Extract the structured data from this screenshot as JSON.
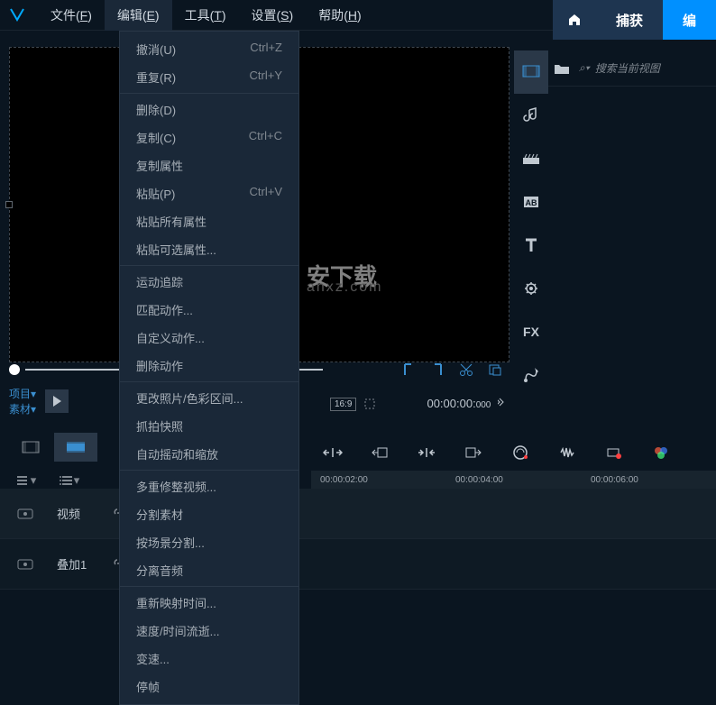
{
  "menubar": {
    "items": [
      {
        "label": "文件",
        "key": "F"
      },
      {
        "label": "编辑",
        "key": "E"
      },
      {
        "label": "工具",
        "key": "T"
      },
      {
        "label": "设置",
        "key": "S"
      },
      {
        "label": "帮助",
        "key": "H"
      }
    ]
  },
  "top_tabs": {
    "capture": "捕获",
    "edit": "编"
  },
  "dropdown": {
    "items": [
      {
        "label": "撤消(U)",
        "shortcut": "Ctrl+Z"
      },
      {
        "label": "重复(R)",
        "shortcut": "Ctrl+Y",
        "sep": true
      },
      {
        "label": "删除(D)",
        "shortcut": ""
      },
      {
        "label": "复制(C)",
        "shortcut": "Ctrl+C"
      },
      {
        "label": "复制属性",
        "shortcut": ""
      },
      {
        "label": "粘贴(P)",
        "shortcut": "Ctrl+V"
      },
      {
        "label": "粘贴所有属性",
        "shortcut": ""
      },
      {
        "label": "粘贴可选属性...",
        "shortcut": "",
        "sep": true
      },
      {
        "label": "运动追踪",
        "shortcut": ""
      },
      {
        "label": "匹配动作...",
        "shortcut": ""
      },
      {
        "label": "自定义动作...",
        "shortcut": ""
      },
      {
        "label": "删除动作",
        "shortcut": "",
        "sep": true
      },
      {
        "label": "更改照片/色彩区间...",
        "shortcut": ""
      },
      {
        "label": "抓拍快照",
        "shortcut": ""
      },
      {
        "label": "自动摇动和缩放",
        "shortcut": "",
        "sep": true
      },
      {
        "label": "多重修整视频...",
        "shortcut": ""
      },
      {
        "label": "分割素材",
        "shortcut": ""
      },
      {
        "label": "按场景分割...",
        "shortcut": ""
      },
      {
        "label": "分离音频",
        "shortcut": "",
        "sep": true
      },
      {
        "label": "重新映射时间...",
        "shortcut": ""
      },
      {
        "label": "速度/时间流逝...",
        "shortcut": ""
      },
      {
        "label": "变速...",
        "shortcut": ""
      },
      {
        "label": "停帧",
        "shortcut": ""
      }
    ]
  },
  "project": {
    "tab1": "项目▾",
    "tab2": "素材▾"
  },
  "aspect": {
    "ratio": "16:9",
    "timecode": "00:00:00:",
    "timecode_ms": "000"
  },
  "timeline": {
    "ticks": [
      "00:00:02:00",
      "00:00:04:00",
      "00:00:06:00"
    ]
  },
  "tracks": [
    {
      "label": "视频"
    },
    {
      "label": "叠加1"
    }
  ],
  "search": {
    "placeholder": "搜索当前视图"
  },
  "watermark": {
    "text": "安下载",
    "sub": "anxz.com"
  },
  "sidebar_labels": {
    "fx": "FX",
    "ab": "AB"
  }
}
